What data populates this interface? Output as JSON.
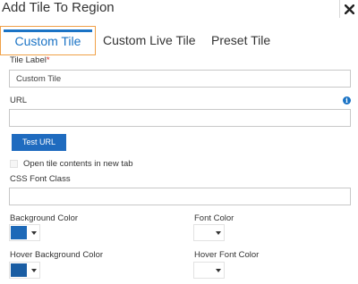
{
  "dialog": {
    "title": "Add Tile To Region",
    "close_icon": "close-icon"
  },
  "tabs": [
    {
      "label": "Custom Tile",
      "active": true
    },
    {
      "label": "Custom Live Tile",
      "active": false
    },
    {
      "label": "Preset Tile",
      "active": false
    }
  ],
  "form": {
    "tile_label": {
      "label": "Tile Label",
      "required_marker": "*",
      "value": "Custom Tile"
    },
    "url": {
      "label": "URL",
      "value": "",
      "info_icon": "info-icon",
      "info_glyph": "i"
    },
    "test_url_button": "Test URL",
    "open_new_tab": {
      "label": "Open tile contents in new tab",
      "checked": false
    },
    "css_font_class": {
      "label": "CSS Font Class",
      "value": ""
    },
    "background_color": {
      "label": "Background Color",
      "swatch": "#1d69b8"
    },
    "font_color": {
      "label": "Font Color",
      "swatch": "#ffffff"
    },
    "hover_background_color": {
      "label": "Hover Background Color",
      "swatch": "#1a5da3"
    },
    "hover_font_color": {
      "label": "Hover Font Color",
      "swatch": "#ffffff"
    }
  },
  "colors": {
    "accent": "#1a73c5",
    "button": "#1f6bbf",
    "tab_focus_border": "#f0a047",
    "required": "#d9241b"
  }
}
